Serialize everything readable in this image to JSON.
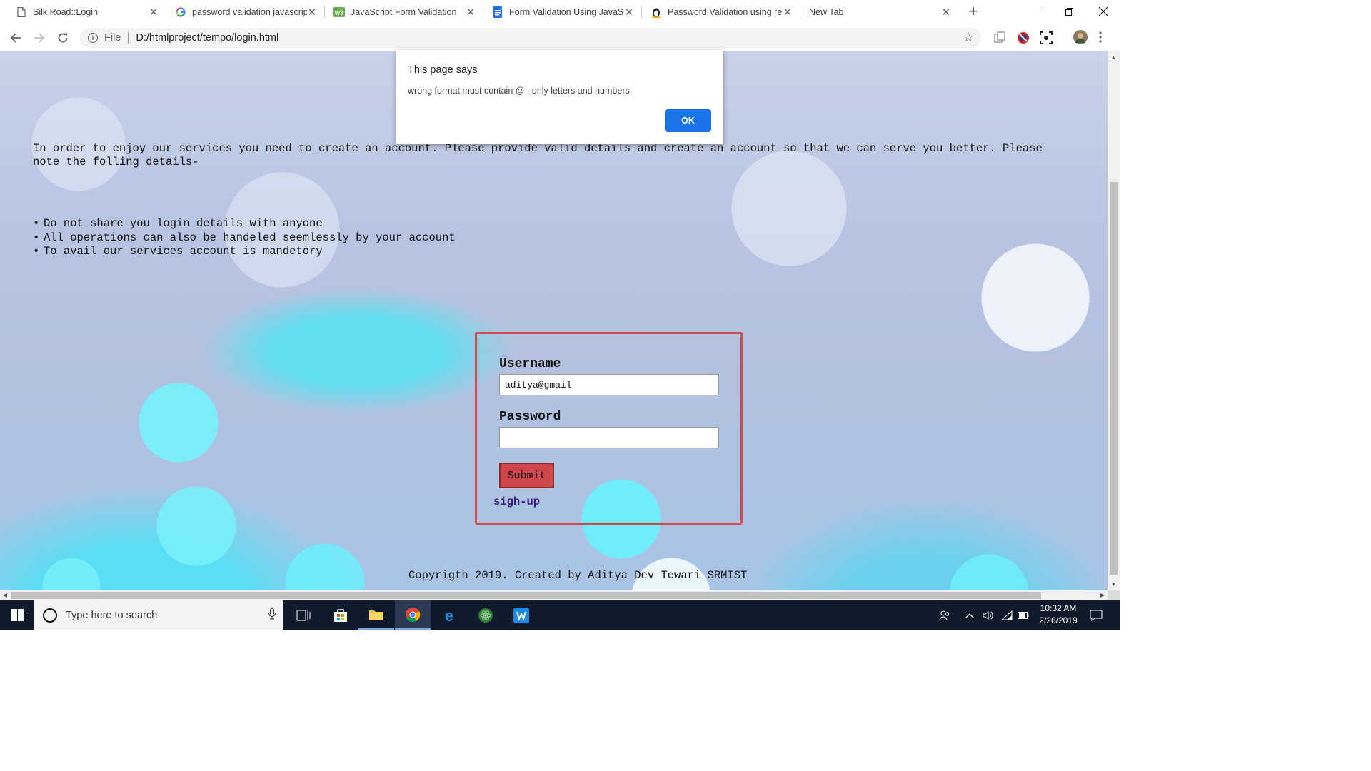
{
  "browser": {
    "tabs": [
      {
        "title": "Silk Road::Login",
        "icon": "page-icon",
        "active": true
      },
      {
        "title": "password validation javascrip",
        "icon": "google-icon",
        "active": false
      },
      {
        "title": "JavaScript Form Validation",
        "icon": "w3resource-icon",
        "active": false
      },
      {
        "title": "Form Validation Using JavaSc",
        "icon": "document-icon",
        "active": false
      },
      {
        "title": "Password Validation using re",
        "icon": "penguin-icon",
        "active": false
      },
      {
        "title": "New Tab",
        "icon": "none",
        "active": false
      }
    ],
    "new_tab_label": "+",
    "address": {
      "scheme_label": "File",
      "url": "D:/htmlproject/tempo/login.html"
    }
  },
  "page": {
    "intro": "In order to enjoy our services you need to create an account. Please provide valid details and create an account so that we can serve you better. Please note the folling details-",
    "bullets": [
      "Do not share you login details with anyone",
      "All operations can also be handeled seemlessly by your account",
      "To avail our services account is mandetory"
    ],
    "form": {
      "username_label": "Username",
      "username_value": "aditya@gmail",
      "password_label": "Password",
      "password_value": "",
      "submit_label": "Submit",
      "signup_link": "sigh-up"
    },
    "footer": "Copyrigth 2019. Created by Aditya Dev Tewari SRMIST"
  },
  "alert": {
    "title": "This page says",
    "message": "wrong format must contain @ . only letters and numbers.",
    "ok_label": "OK"
  },
  "taskbar": {
    "search_placeholder": "Type here to search",
    "time": "10:32 AM",
    "date": "2/26/2019"
  },
  "colors": {
    "form_border": "#d24b4b",
    "submit_bg": "#d0464b",
    "ok_button": "#1a73e8",
    "signup_link": "#3c1a7a",
    "taskbar": "#0f1a2b"
  }
}
